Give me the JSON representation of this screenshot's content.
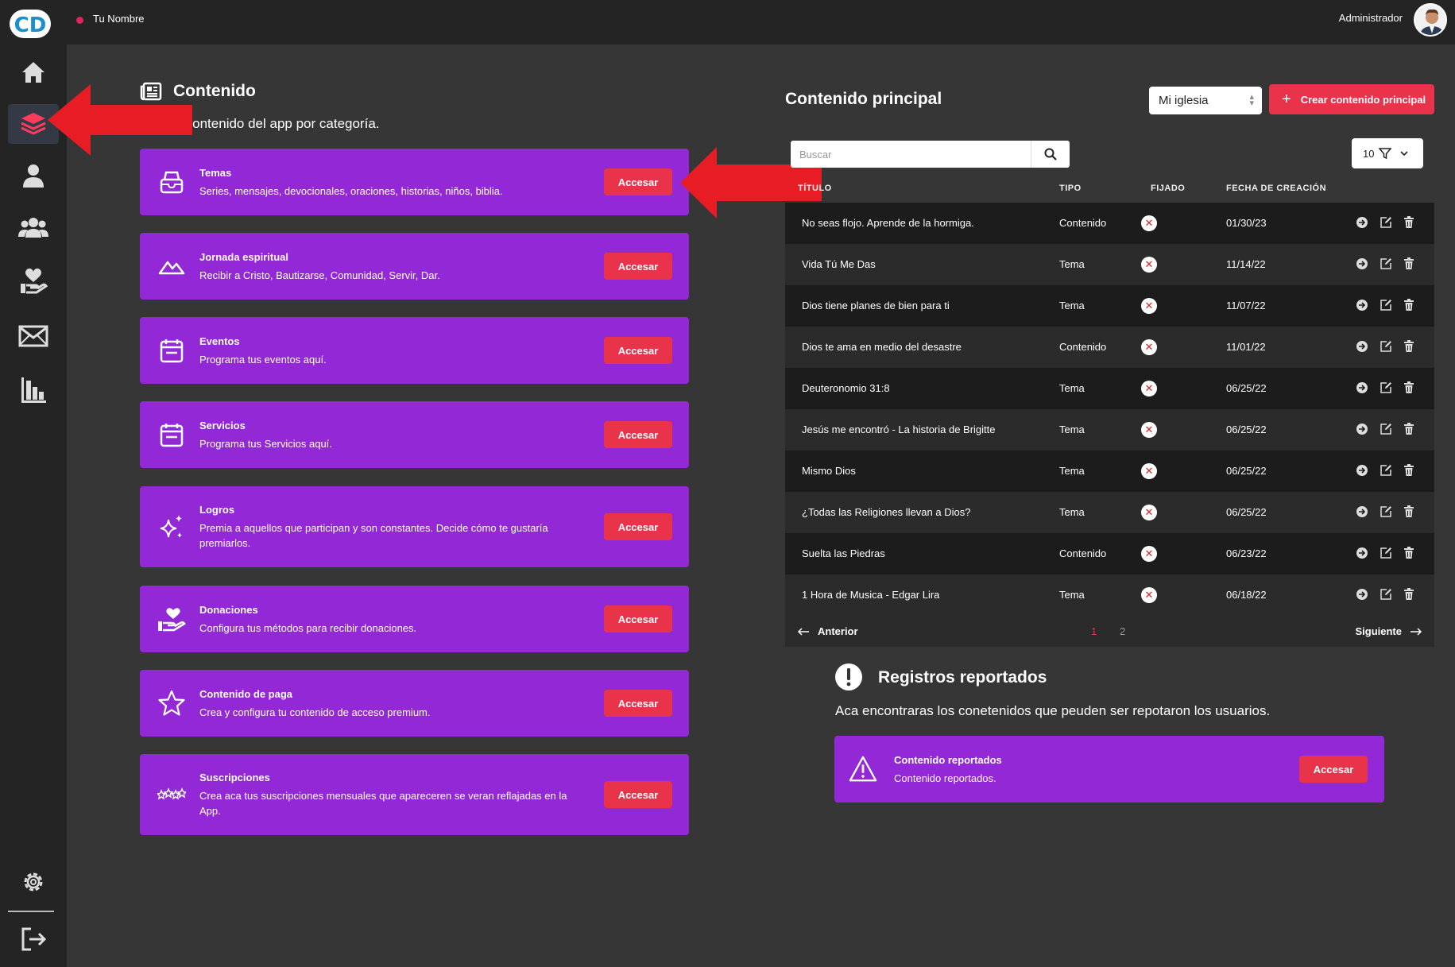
{
  "topbar": {
    "user_name": "Tu Nombre",
    "role": "Administrador"
  },
  "sidebar": {
    "logo_text": "CD"
  },
  "content": {
    "title": "Contenido",
    "subtitle": "Aquí el contenido del app por categoría.",
    "cards": [
      {
        "title": "Temas",
        "desc": "Series, mensajes, devocionales, oraciones, historias, niños, biblia.",
        "button": "Accesar"
      },
      {
        "title": "Jornada espiritual",
        "desc": "Recibir a Cristo, Bautizarse, Comunidad, Servir, Dar.",
        "button": "Accesar"
      },
      {
        "title": "Eventos",
        "desc": "Programa tus eventos aquí.",
        "button": "Accesar"
      },
      {
        "title": "Servicios",
        "desc": "Programa tus Servicios aquí.",
        "button": "Accesar"
      },
      {
        "title": "Logros",
        "desc": "Premia a aquellos que participan y son constantes. Decide cómo te gustaría premiarlos.",
        "button": "Accesar"
      },
      {
        "title": "Donaciones",
        "desc": "Configura tus métodos para recibir donaciones.",
        "button": "Accesar"
      },
      {
        "title": "Contenido de paga",
        "desc": "Crea y configura tu contenido de acceso premium.",
        "button": "Accesar"
      },
      {
        "title": "Suscripciones",
        "desc": "Crea aca tus suscripciones mensuales que apareceren se veran reflajadas en la App.",
        "button": "Accesar"
      }
    ]
  },
  "main": {
    "title": "Contenido principal",
    "church_select": "Mi iglesia",
    "create_button": "Crear contenido principal",
    "search_placeholder": "Buscar",
    "per_page": "10",
    "columns": [
      "TÍTULO",
      "TIPO",
      "FIJADO",
      "FECHA DE CREACIÓN"
    ],
    "rows": [
      {
        "title": "No seas flojo. Aprende de la hormiga.",
        "type": "Contenido",
        "date": "01/30/23"
      },
      {
        "title": "Vida Tú Me Das",
        "type": "Tema",
        "date": "11/14/22"
      },
      {
        "title": "Dios tiene planes de bien para ti",
        "type": "Tema",
        "date": "11/07/22"
      },
      {
        "title": "Dios te ama en medio del desastre",
        "type": "Contenido",
        "date": "11/01/22"
      },
      {
        "title": "Deuteronomio 31:8",
        "type": "Tema",
        "date": "06/25/22"
      },
      {
        "title": "Jesús me encontró - La historia de Brigitte",
        "type": "Tema",
        "date": "06/25/22"
      },
      {
        "title": "Mismo Dios",
        "type": "Tema",
        "date": "06/25/22"
      },
      {
        "title": "¿Todas las Religiones llevan a Dios?",
        "type": "Tema",
        "date": "06/25/22"
      },
      {
        "title": "Suelta las Piedras",
        "type": "Contenido",
        "date": "06/23/22"
      },
      {
        "title": "1 Hora de Musica - Edgar Lira",
        "type": "Tema",
        "date": "06/18/22"
      }
    ],
    "pager": {
      "prev": "Anterior",
      "pages": [
        "1",
        "2"
      ],
      "next": "Siguiente"
    }
  },
  "reports": {
    "title": "Registros reportados",
    "subtitle": "Aca encontraras los conetenidos que peuden ser repotaron los usuarios.",
    "card": {
      "title": "Contenido reportados",
      "desc": "Contenido reportados.",
      "button": "Accesar"
    }
  },
  "colors": {
    "accent": "#e8334a",
    "card": "#9328d6",
    "arrow": "#e81c24"
  }
}
